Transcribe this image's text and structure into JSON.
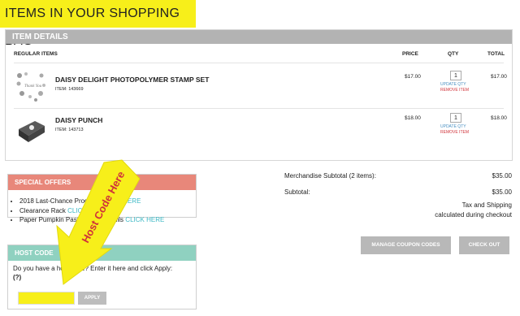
{
  "page_title": "ITEMS IN YOUR SHOPPING BAG",
  "bag": {
    "header": "ITEM DETAILS",
    "columns": {
      "items": "REGULAR ITEMS",
      "price": "PRICE",
      "qty": "QTY",
      "total": "TOTAL"
    },
    "rows": [
      {
        "name": "DAISY DELIGHT PHOTOPOLYMER STAMP SET",
        "item": "ITEM: 143669",
        "price": "$17.00",
        "qty": "1",
        "update": "UPDATE QTY",
        "remove": "REMOVE ITEM",
        "total": "$17.00",
        "thumb_text": "Thank You"
      },
      {
        "name": "DAISY PUNCH",
        "item": "ITEM: 143713",
        "price": "$18.00",
        "qty": "1",
        "update": "UPDATE QTY",
        "remove": "REMOVE ITEM",
        "total": "$18.00"
      }
    ]
  },
  "special_offers": {
    "header": "SPECIAL OFFERS",
    "items": [
      {
        "text": "2018 Last-Chance Products",
        "link": "CLICK HERE"
      },
      {
        "text": "Clearance Rack",
        "link": "CLICK HERE"
      },
      {
        "text": "Paper Pumpkin Past Kits and Refills",
        "link": "CLICK HERE"
      }
    ]
  },
  "host_code": {
    "header": "HOST CODE",
    "prompt": "Do you have a host code? Enter it here and click Apply:",
    "help": "(?)",
    "input_value": "",
    "apply_label": "APPLY"
  },
  "summary": {
    "merch_label": "Merchandise Subtotal (2 items):",
    "merch_value": "$35.00",
    "subtotal_label": "Subtotal:",
    "subtotal_value": "$35.00",
    "tax_line1": "Tax and Shipping",
    "tax_line2": "calculated during checkout"
  },
  "buttons": {
    "coupon": "MANAGE COUPON CODES",
    "checkout": "CHECK OUT"
  },
  "annotation": {
    "text": "Host Code Here",
    "color": "#f7ef1a",
    "text_color": "#d0333a"
  },
  "colors": {
    "offers_header": "#e8877a",
    "host_header": "#8fd1c0",
    "highlight": "#f7ef1a",
    "link": "#3cb8c5"
  }
}
